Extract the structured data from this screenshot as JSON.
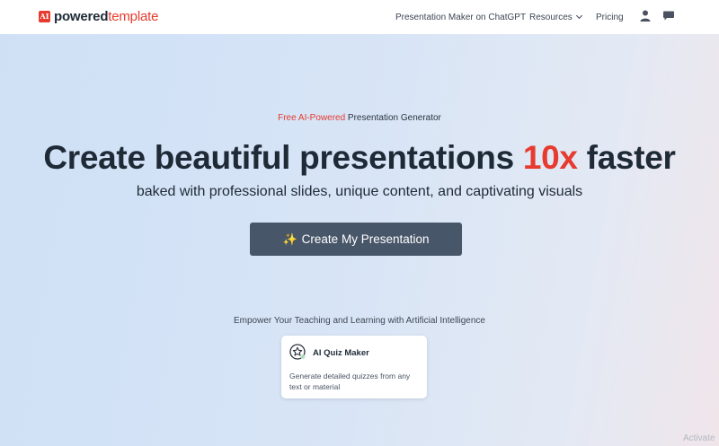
{
  "header": {
    "logo": {
      "mark": "AI",
      "text_bold": "powered",
      "text_accent": "template"
    },
    "nav": {
      "gpt": "Presentation Maker on ChatGPT",
      "resources": "Resources",
      "pricing": "Pricing"
    },
    "icons": [
      "user-icon",
      "chat-icon",
      "chevron-down-icon"
    ]
  },
  "hero": {
    "eyebrow_accent": "Free AI-Powered",
    "eyebrow_rest": " Presentation Generator",
    "headline_pre": "Create beautiful presentations ",
    "headline_accent": "10x",
    "headline_post": " faster",
    "subline": "baked with professional slides, unique content, and captivating visuals",
    "cta_icon": "✨",
    "cta_label": "Create My Presentation"
  },
  "section": {
    "tagline": "Empower Your Teaching and Learning with Artificial Intelligence",
    "card": {
      "icon": "star-badge-icon",
      "title": "AI Quiz Maker",
      "description": "Generate detailed quizzes from any text or material"
    }
  },
  "watermark": "Activate",
  "colors": {
    "accent": "#e63b2e",
    "cta_bg": "#48566a",
    "text": "#1f2a37"
  }
}
